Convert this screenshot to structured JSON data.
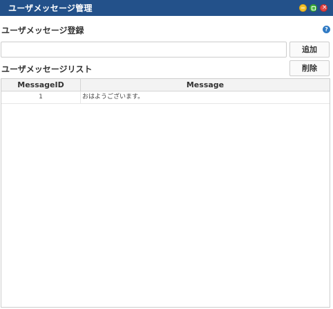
{
  "window": {
    "title": "ユーザメッセージ管理",
    "controls": [
      "minimize-icon",
      "maximize-icon",
      "close-icon"
    ]
  },
  "register": {
    "heading": "ユーザメッセージ登録",
    "input_value": "",
    "add_label": "追加",
    "help_icon": "question-icon",
    "help_glyph": "?"
  },
  "list": {
    "heading": "ユーザメッセージリスト",
    "delete_label": "削除",
    "columns": [
      "MessageID",
      "Message"
    ],
    "rows": [
      {
        "id": "1",
        "message": "おはようございます。"
      }
    ]
  },
  "colors": {
    "titlebar": "#23518a",
    "minimize": "#f2c12e",
    "maximize": "#4cb848",
    "close": "#e04848",
    "help": "#2f7ac4"
  }
}
